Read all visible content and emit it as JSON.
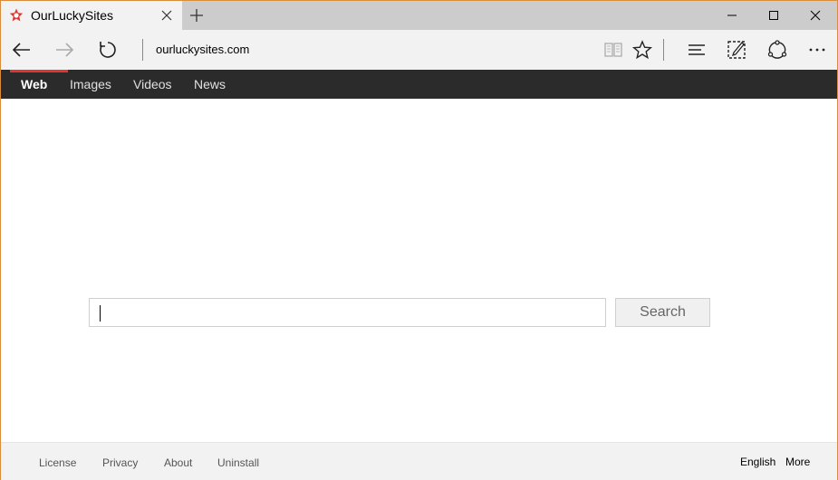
{
  "browser": {
    "tab_title": "OurLuckySites",
    "address": "ourluckysites.com"
  },
  "site": {
    "nav_tabs": [
      {
        "label": "Web",
        "active": true
      },
      {
        "label": "Images",
        "active": false
      },
      {
        "label": "Videos",
        "active": false
      },
      {
        "label": "News",
        "active": false
      }
    ],
    "search_value": "",
    "search_button": "Search"
  },
  "footer": {
    "links": [
      "License",
      "Privacy",
      "About",
      "Uninstall"
    ],
    "language": "English",
    "more": "More"
  },
  "colors": {
    "header_bg": "#2b2b2b",
    "active_tab_accent": "#e3342f",
    "window_border": "#d98c3a"
  },
  "icons": [
    "favicon-icon",
    "close-icon",
    "plus-icon",
    "minimize-icon",
    "maximize-icon",
    "back-icon",
    "forward-icon",
    "refresh-icon",
    "reading-view-icon",
    "star-icon",
    "hub-icon",
    "web-note-icon",
    "share-icon",
    "more-icon"
  ]
}
